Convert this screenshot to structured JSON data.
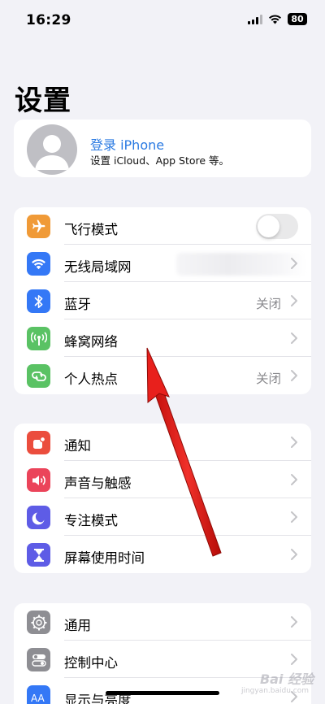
{
  "status_bar": {
    "time": "16:29",
    "battery": "80",
    "icons": [
      "signal-icon",
      "wifi-icon",
      "battery-icon"
    ]
  },
  "page": {
    "title": "设置"
  },
  "profile": {
    "title": "登录 iPhone",
    "subtitle": "设置 iCloud、App Store 等。"
  },
  "groups": {
    "connectivity": [
      {
        "label": "飞行模式",
        "icon": "airplane-icon",
        "color": "#f09a37",
        "toggle": false
      },
      {
        "label": "无线局域网",
        "icon": "wifi-icon",
        "color": "#3478f6",
        "value": ""
      },
      {
        "label": "蓝牙",
        "icon": "bluetooth-icon",
        "color": "#3478f6",
        "value": "关闭"
      },
      {
        "label": "蜂窝网络",
        "icon": "cellular-icon",
        "color": "#5ac264",
        "value": ""
      },
      {
        "label": "个人热点",
        "icon": "hotspot-icon",
        "color": "#5ac264",
        "value": "关闭"
      }
    ],
    "notifications": [
      {
        "label": "通知",
        "icon": "notification-icon",
        "color": "#eb4d3d"
      },
      {
        "label": "声音与触感",
        "icon": "sound-icon",
        "color": "#eb445a"
      },
      {
        "label": "专注模式",
        "icon": "moon-icon",
        "color": "#5e5ce6"
      },
      {
        "label": "屏幕使用时间",
        "icon": "hourglass-icon",
        "color": "#5e5ce6"
      }
    ],
    "general": [
      {
        "label": "通用",
        "icon": "gear-icon",
        "color": "#8e8e93"
      },
      {
        "label": "控制中心",
        "icon": "toggles-icon",
        "color": "#8e8e93"
      },
      {
        "label": "显示与亮度",
        "icon": "display-icon",
        "color": "#3478f6"
      }
    ]
  },
  "watermark": {
    "text": "Bai 经验",
    "sub": "jingyan.baidu.com"
  },
  "annotation": {
    "arrow_color": "#e8201c"
  }
}
